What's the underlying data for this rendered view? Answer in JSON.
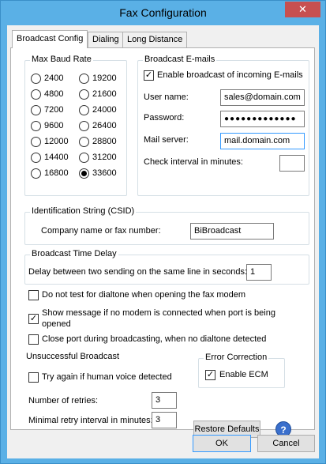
{
  "window": {
    "title": "Fax Configuration",
    "close_glyph": "✕"
  },
  "tabs": [
    {
      "label": "Broadcast Config",
      "active": true
    },
    {
      "label": "Dialing",
      "active": false
    },
    {
      "label": "Long Distance",
      "active": false
    }
  ],
  "baud": {
    "title": "Max Baud Rate",
    "options": [
      "2400",
      "4800",
      "7200",
      "9600",
      "12000",
      "14400",
      "16800",
      "19200",
      "21600",
      "24000",
      "26400",
      "28800",
      "31200",
      "33600"
    ],
    "selected": "33600"
  },
  "emails": {
    "title": "Broadcast E-mails",
    "enable_label": "Enable broadcast of incoming E-mails",
    "enable_checked": true,
    "username_label": "User name:",
    "username_value": "sales@domain.com",
    "password_label": "Password:",
    "password_value": "●●●●●●●●●●●●●",
    "server_label": "Mail server:",
    "server_value": "mail.domain.com",
    "interval_label": "Check interval in minutes:",
    "interval_value": ""
  },
  "csid": {
    "title": "Identification String (CSID)",
    "label": "Company name or fax number:",
    "value": "BiBroadcast"
  },
  "timedelay": {
    "title": "Broadcast Time Delay",
    "label": "Delay between two sending on the same line in seconds:",
    "value": "1"
  },
  "options": {
    "no_dialtone": {
      "label": "Do not test for dialtone when opening the fax modem",
      "checked": false
    },
    "show_message_1": "Show message if no modem is connected when port is being",
    "show_message_2": "opened",
    "show_message_checked": true,
    "close_port": {
      "label": "Close port during broadcasting, when no dialtone detected",
      "checked": false
    }
  },
  "unsuccessful": {
    "title": "Unsuccessful Broadcast",
    "try_again_label": "Try again if human voice detected",
    "try_again_checked": false,
    "retries_label": "Number of retries:",
    "retries_value": "3",
    "minimal_label": "Minimal retry interval in minutes:",
    "minimal_value": "3"
  },
  "ecm": {
    "title": "Error Correction",
    "label": "Enable ECM",
    "checked": true
  },
  "buttons": {
    "restore": "Restore Defaults",
    "help_glyph": "?",
    "ok": "OK",
    "cancel": "Cancel"
  },
  "check_glyph": "✓"
}
